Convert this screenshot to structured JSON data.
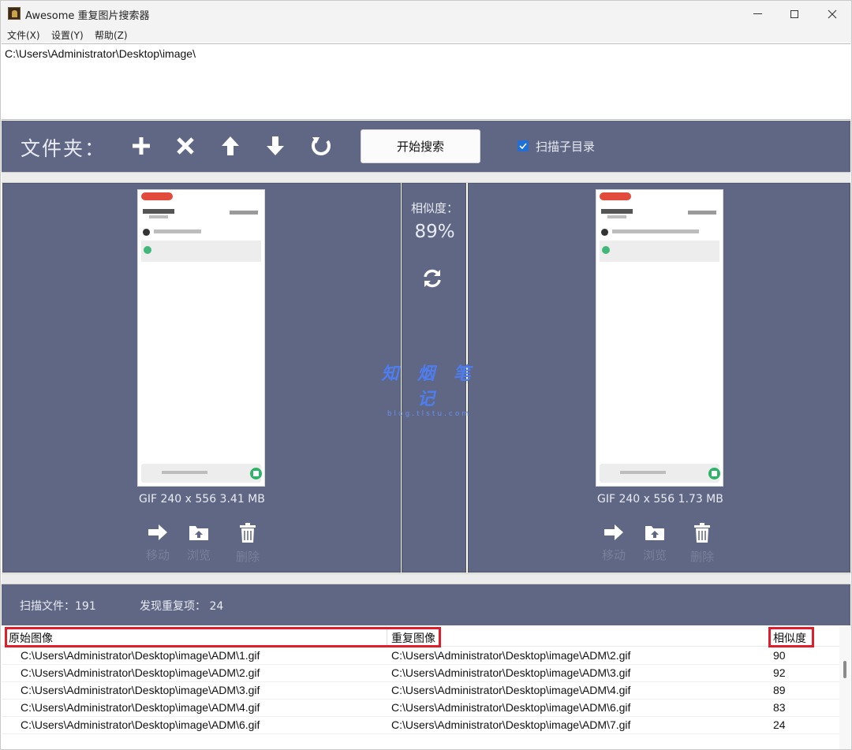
{
  "window": {
    "title": "Awesome 重复图片搜索器"
  },
  "menu": [
    "文件(X)",
    "设置(Y)",
    "帮助(Z)"
  ],
  "path": "C:\\Users\\Administrator\\Desktop\\image\\",
  "toolbar": {
    "label": "文件夹：",
    "icons": [
      "add-icon",
      "remove-icon",
      "move-up-icon",
      "move-down-icon",
      "refresh-icon"
    ],
    "start_button": "开始搜索",
    "scan_subdirs_label": "扫描子目录",
    "scan_subdirs_checked": true
  },
  "left_preview": {
    "info": "GIF  240 x 556  3.41 MB",
    "actions": [
      "移动",
      "浏览",
      "删除"
    ]
  },
  "right_preview": {
    "info": "GIF  240 x 556  1.73 MB",
    "actions": [
      "移动",
      "浏览",
      "删除"
    ]
  },
  "similarity": {
    "label": "相似度：",
    "value": "89%"
  },
  "watermark": {
    "title": "知 烟 笔 记",
    "sub": "blog.tlstu.com"
  },
  "stats": {
    "scanned": "扫描文件：191",
    "found": "发现重复项： 24"
  },
  "table": {
    "headers": [
      "原始图像",
      "重复图像",
      "相似度"
    ],
    "rows": [
      {
        "orig": "C:\\Users\\Administrator\\Desktop\\image\\ADM\\1.gif",
        "dup": "C:\\Users\\Administrator\\Desktop\\image\\ADM\\2.gif",
        "sim": "90"
      },
      {
        "orig": "C:\\Users\\Administrator\\Desktop\\image\\ADM\\2.gif",
        "dup": "C:\\Users\\Administrator\\Desktop\\image\\ADM\\3.gif",
        "sim": "92"
      },
      {
        "orig": "C:\\Users\\Administrator\\Desktop\\image\\ADM\\3.gif",
        "dup": "C:\\Users\\Administrator\\Desktop\\image\\ADM\\4.gif",
        "sim": "89"
      },
      {
        "orig": "C:\\Users\\Administrator\\Desktop\\image\\ADM\\4.gif",
        "dup": "C:\\Users\\Administrator\\Desktop\\image\\ADM\\6.gif",
        "sim": "83"
      },
      {
        "orig": "C:\\Users\\Administrator\\Desktop\\image\\ADM\\6.gif",
        "dup": "C:\\Users\\Administrator\\Desktop\\image\\ADM\\7.gif",
        "sim": "24"
      }
    ]
  },
  "colors": {
    "panel": "#5f6784",
    "highlight": "#e11d2b",
    "checkbox": "#1f6fd6"
  }
}
